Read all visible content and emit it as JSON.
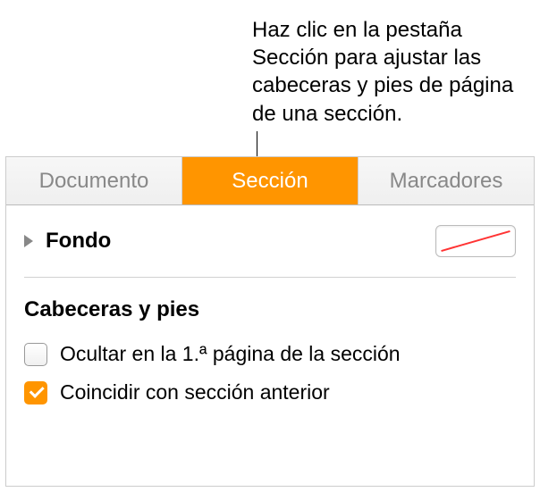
{
  "callout": {
    "text": "Haz clic en la pestaña Sección para ajustar las cabeceras y pies de página de una sección."
  },
  "tabs": {
    "document": "Documento",
    "section": "Sección",
    "bookmarks": "Marcadores"
  },
  "background": {
    "label": "Fondo"
  },
  "headers_footers": {
    "title": "Cabeceras y pies",
    "hide_first_page": {
      "label": "Ocultar en la 1.ª página de la sección",
      "checked": false
    },
    "match_previous": {
      "label": "Coincidir con sección anterior",
      "checked": true
    }
  }
}
